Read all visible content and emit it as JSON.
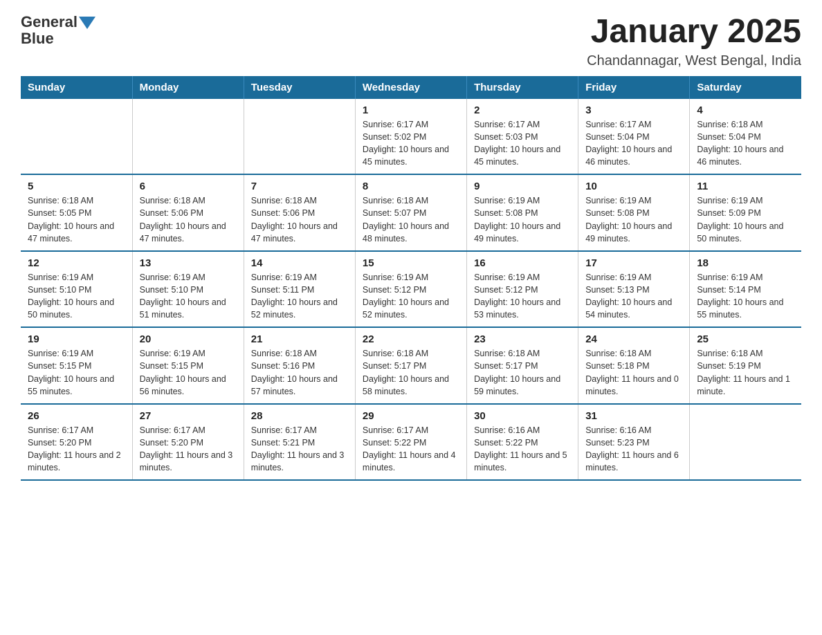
{
  "header": {
    "logo_line1": "General",
    "logo_line2": "Blue",
    "title": "January 2025",
    "subtitle": "Chandannagar, West Bengal, India"
  },
  "days_of_week": [
    "Sunday",
    "Monday",
    "Tuesday",
    "Wednesday",
    "Thursday",
    "Friday",
    "Saturday"
  ],
  "weeks": [
    [
      {
        "day": "",
        "info": ""
      },
      {
        "day": "",
        "info": ""
      },
      {
        "day": "",
        "info": ""
      },
      {
        "day": "1",
        "info": "Sunrise: 6:17 AM\nSunset: 5:02 PM\nDaylight: 10 hours\nand 45 minutes."
      },
      {
        "day": "2",
        "info": "Sunrise: 6:17 AM\nSunset: 5:03 PM\nDaylight: 10 hours\nand 45 minutes."
      },
      {
        "day": "3",
        "info": "Sunrise: 6:17 AM\nSunset: 5:04 PM\nDaylight: 10 hours\nand 46 minutes."
      },
      {
        "day": "4",
        "info": "Sunrise: 6:18 AM\nSunset: 5:04 PM\nDaylight: 10 hours\nand 46 minutes."
      }
    ],
    [
      {
        "day": "5",
        "info": "Sunrise: 6:18 AM\nSunset: 5:05 PM\nDaylight: 10 hours\nand 47 minutes."
      },
      {
        "day": "6",
        "info": "Sunrise: 6:18 AM\nSunset: 5:06 PM\nDaylight: 10 hours\nand 47 minutes."
      },
      {
        "day": "7",
        "info": "Sunrise: 6:18 AM\nSunset: 5:06 PM\nDaylight: 10 hours\nand 47 minutes."
      },
      {
        "day": "8",
        "info": "Sunrise: 6:18 AM\nSunset: 5:07 PM\nDaylight: 10 hours\nand 48 minutes."
      },
      {
        "day": "9",
        "info": "Sunrise: 6:19 AM\nSunset: 5:08 PM\nDaylight: 10 hours\nand 49 minutes."
      },
      {
        "day": "10",
        "info": "Sunrise: 6:19 AM\nSunset: 5:08 PM\nDaylight: 10 hours\nand 49 minutes."
      },
      {
        "day": "11",
        "info": "Sunrise: 6:19 AM\nSunset: 5:09 PM\nDaylight: 10 hours\nand 50 minutes."
      }
    ],
    [
      {
        "day": "12",
        "info": "Sunrise: 6:19 AM\nSunset: 5:10 PM\nDaylight: 10 hours\nand 50 minutes."
      },
      {
        "day": "13",
        "info": "Sunrise: 6:19 AM\nSunset: 5:10 PM\nDaylight: 10 hours\nand 51 minutes."
      },
      {
        "day": "14",
        "info": "Sunrise: 6:19 AM\nSunset: 5:11 PM\nDaylight: 10 hours\nand 52 minutes."
      },
      {
        "day": "15",
        "info": "Sunrise: 6:19 AM\nSunset: 5:12 PM\nDaylight: 10 hours\nand 52 minutes."
      },
      {
        "day": "16",
        "info": "Sunrise: 6:19 AM\nSunset: 5:12 PM\nDaylight: 10 hours\nand 53 minutes."
      },
      {
        "day": "17",
        "info": "Sunrise: 6:19 AM\nSunset: 5:13 PM\nDaylight: 10 hours\nand 54 minutes."
      },
      {
        "day": "18",
        "info": "Sunrise: 6:19 AM\nSunset: 5:14 PM\nDaylight: 10 hours\nand 55 minutes."
      }
    ],
    [
      {
        "day": "19",
        "info": "Sunrise: 6:19 AM\nSunset: 5:15 PM\nDaylight: 10 hours\nand 55 minutes."
      },
      {
        "day": "20",
        "info": "Sunrise: 6:19 AM\nSunset: 5:15 PM\nDaylight: 10 hours\nand 56 minutes."
      },
      {
        "day": "21",
        "info": "Sunrise: 6:18 AM\nSunset: 5:16 PM\nDaylight: 10 hours\nand 57 minutes."
      },
      {
        "day": "22",
        "info": "Sunrise: 6:18 AM\nSunset: 5:17 PM\nDaylight: 10 hours\nand 58 minutes."
      },
      {
        "day": "23",
        "info": "Sunrise: 6:18 AM\nSunset: 5:17 PM\nDaylight: 10 hours\nand 59 minutes."
      },
      {
        "day": "24",
        "info": "Sunrise: 6:18 AM\nSunset: 5:18 PM\nDaylight: 11 hours\nand 0 minutes."
      },
      {
        "day": "25",
        "info": "Sunrise: 6:18 AM\nSunset: 5:19 PM\nDaylight: 11 hours\nand 1 minute."
      }
    ],
    [
      {
        "day": "26",
        "info": "Sunrise: 6:17 AM\nSunset: 5:20 PM\nDaylight: 11 hours\nand 2 minutes."
      },
      {
        "day": "27",
        "info": "Sunrise: 6:17 AM\nSunset: 5:20 PM\nDaylight: 11 hours\nand 3 minutes."
      },
      {
        "day": "28",
        "info": "Sunrise: 6:17 AM\nSunset: 5:21 PM\nDaylight: 11 hours\nand 3 minutes."
      },
      {
        "day": "29",
        "info": "Sunrise: 6:17 AM\nSunset: 5:22 PM\nDaylight: 11 hours\nand 4 minutes."
      },
      {
        "day": "30",
        "info": "Sunrise: 6:16 AM\nSunset: 5:22 PM\nDaylight: 11 hours\nand 5 minutes."
      },
      {
        "day": "31",
        "info": "Sunrise: 6:16 AM\nSunset: 5:23 PM\nDaylight: 11 hours\nand 6 minutes."
      },
      {
        "day": "",
        "info": ""
      }
    ]
  ]
}
